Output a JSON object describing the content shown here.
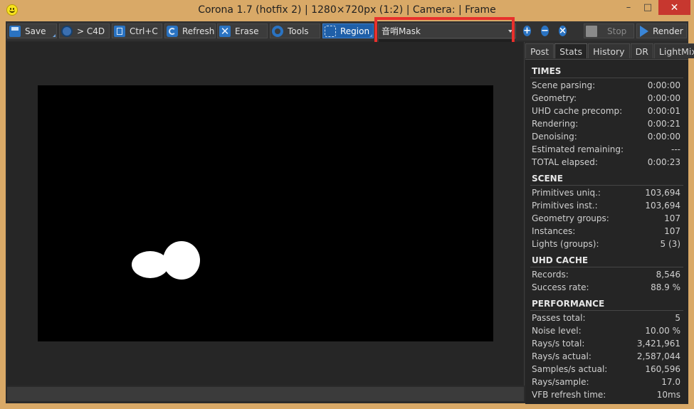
{
  "window": {
    "title": "Corona 1.7 (hotfix 2) | 1280×720px (1:2) | Camera:  | Frame",
    "minimize": "–",
    "maximize": "□",
    "close": "✕"
  },
  "toolbar": {
    "save": "Save",
    "to_c4d": "> C4D",
    "copy": "Ctrl+C",
    "refresh": "Refresh",
    "erase": "Erase",
    "tools": "Tools",
    "region": "Region",
    "channel_selected": "音哨Mask",
    "zoom_in": "+",
    "zoom_out": "−",
    "zoom_fit": "×",
    "stop": "Stop",
    "render": "Render"
  },
  "panel": {
    "tabs": [
      "Post",
      "Stats",
      "History",
      "DR",
      "LightMix"
    ],
    "active_tab": "Stats",
    "sections": [
      {
        "title": "TIMES",
        "rows": [
          [
            "Scene parsing:",
            "0:00:00"
          ],
          [
            "Geometry:",
            "0:00:00"
          ],
          [
            "UHD cache precomp:",
            "0:00:01"
          ],
          [
            "Rendering:",
            "0:00:21"
          ],
          [
            "Denoising:",
            "0:00:00"
          ],
          [
            "Estimated remaining:",
            "---"
          ],
          [
            "TOTAL elapsed:",
            "0:00:23"
          ]
        ]
      },
      {
        "title": "SCENE",
        "rows": [
          [
            "Primitives uniq.:",
            "103,694"
          ],
          [
            "Primitives inst.:",
            "103,694"
          ],
          [
            "Geometry groups:",
            "107"
          ],
          [
            "Instances:",
            "107"
          ],
          [
            "Lights (groups):",
            "5 (3)"
          ]
        ]
      },
      {
        "title": "UHD CACHE",
        "rows": [
          [
            "Records:",
            "8,546"
          ],
          [
            "Success rate:",
            "88.9 %"
          ]
        ]
      },
      {
        "title": "PERFORMANCE",
        "rows": [
          [
            "Passes total:",
            "5"
          ],
          [
            "Noise level:",
            "10.00 %"
          ],
          [
            "Rays/s total:",
            "3,421,961"
          ],
          [
            "Rays/s actual:",
            "2,587,044"
          ],
          [
            "Samples/s actual:",
            "160,596"
          ],
          [
            "Rays/sample:",
            "17.0"
          ],
          [
            "VFB refresh time:",
            "10ms"
          ]
        ]
      }
    ]
  },
  "colors": {
    "frame": "#d9a967",
    "background": "#2b2b2b",
    "accent": "#2a73c2",
    "highlight": "#e8302c"
  }
}
